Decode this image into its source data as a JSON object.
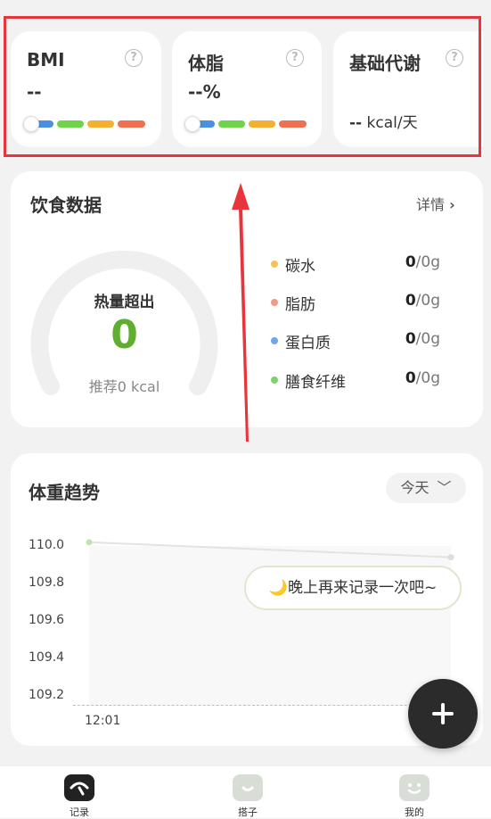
{
  "metrics": [
    {
      "title": "BMI",
      "value": "--"
    },
    {
      "title": "体脂",
      "value": "--%"
    },
    {
      "title": "基础代谢",
      "value": "--",
      "unit": "kcal/天"
    }
  ],
  "diet": {
    "title": "饮食数据",
    "detail_label": "详情",
    "gauge_label": "热量超出",
    "gauge_value": "0",
    "recommend": "推荐0 kcal",
    "nutrients": [
      {
        "name": "碳水",
        "value": "0",
        "total": "/0g",
        "color": "#f5c25a"
      },
      {
        "name": "脂肪",
        "value": "0",
        "total": "/0g",
        "color": "#ef9a87"
      },
      {
        "name": "蛋白质",
        "value": "0",
        "total": "/0g",
        "color": "#6fa6ee"
      },
      {
        "name": "膳食纤维",
        "value": "0",
        "total": "/0g",
        "color": "#7bd36b"
      }
    ]
  },
  "weight": {
    "title": "体重趋势",
    "period_select": "今天",
    "tooltip": "🌙晚上再来记录一次吧~"
  },
  "chart_data": {
    "type": "line",
    "x": [
      "12:01",
      ""
    ],
    "xlabels": [
      "12:01"
    ],
    "series": [
      {
        "values": [
          110.02,
          109.94
        ]
      }
    ],
    "yticks": [
      "110.0",
      "109.8",
      "109.6",
      "109.4",
      "109.2"
    ],
    "ylim": [
      109.2,
      110.0
    ],
    "grid": false
  },
  "nav": [
    {
      "label": "记录",
      "icon": "record-icon"
    },
    {
      "label": "搭子",
      "icon": "partner-icon"
    },
    {
      "label": "我的",
      "icon": "profile-icon"
    }
  ],
  "fab_icon": "plus-icon",
  "colors": {
    "green": "#5fae2f",
    "seg_blue": "#4a90e2",
    "seg_green": "#6dd44b",
    "seg_orange": "#f5b031",
    "seg_red": "#ef6f52",
    "highlight_red": "#e8343b"
  }
}
